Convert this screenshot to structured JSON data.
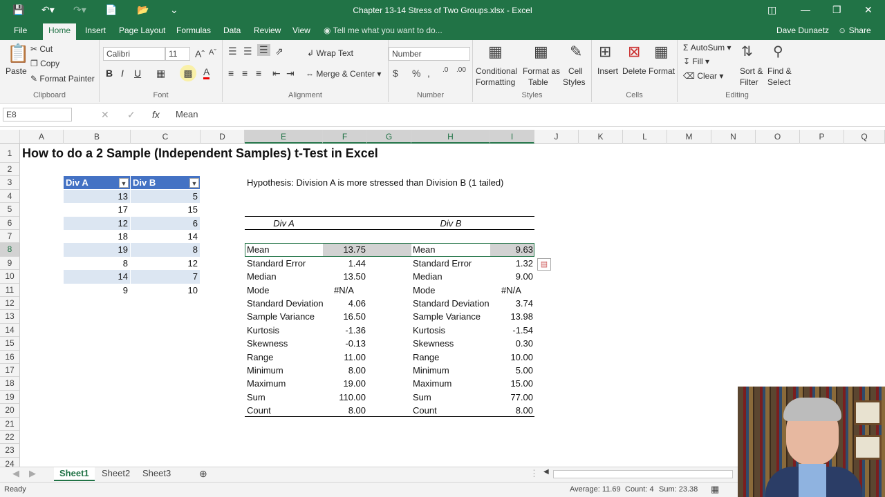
{
  "window": {
    "title": "Chapter 13-14 Stress of Two Groups.xlsx - Excel"
  },
  "quick_access": {
    "save": "save-icon",
    "undo": "undo-icon",
    "redo": "redo-icon"
  },
  "tabs": [
    {
      "label": "File"
    },
    {
      "label": "Home"
    },
    {
      "label": "Insert"
    },
    {
      "label": "Page Layout"
    },
    {
      "label": "Formulas"
    },
    {
      "label": "Data"
    },
    {
      "label": "Review"
    },
    {
      "label": "View"
    }
  ],
  "tell_me": "Tell me what you want to do...",
  "user": "Dave Dunaetz",
  "share": "Share",
  "ribbon": {
    "clipboard": {
      "paste": "Paste",
      "cut": "Cut",
      "copy": "Copy",
      "format_painter": "Format Painter",
      "label": "Clipboard"
    },
    "font": {
      "name": "Calibri",
      "size": "11",
      "label": "Font",
      "bold": "B",
      "italic": "I",
      "underline": "U"
    },
    "alignment": {
      "wrap": "Wrap Text",
      "merge": "Merge & Center",
      "label": "Alignment"
    },
    "number": {
      "format": "Number",
      "label": "Number"
    },
    "styles": {
      "cond": "Conditional",
      "cond2": "Formatting",
      "fmt_table": "Format as",
      "fmt_table2": "Table",
      "cell_styles": "Cell",
      "cell_styles2": "Styles",
      "label": "Styles"
    },
    "cells": {
      "insert": "Insert",
      "delete": "Delete",
      "format": "Format",
      "label": "Cells"
    },
    "editing": {
      "autosum": "AutoSum",
      "fill": "Fill",
      "clear": "Clear",
      "sort": "Sort &",
      "sort2": "Filter",
      "find": "Find &",
      "find2": "Select",
      "label": "Editing"
    }
  },
  "formula_bar": {
    "name_box": "E8",
    "formula": "Mean"
  },
  "columns": [
    "A",
    "B",
    "C",
    "D",
    "E",
    "F",
    "G",
    "H",
    "I",
    "J",
    "K",
    "L",
    "M",
    "N",
    "O",
    "P",
    "Q"
  ],
  "rows": [
    "1",
    "2",
    "3",
    "4",
    "5",
    "6",
    "7",
    "8",
    "9",
    "10",
    "11",
    "12",
    "13",
    "14",
    "15",
    "16",
    "17",
    "18",
    "19",
    "20",
    "21",
    "22",
    "23",
    "24"
  ],
  "sheet": {
    "title": "How to do a 2 Sample (Independent Samples) t-Test in Excel",
    "hypothesis": "Hypothesis: Division A is more stressed than Division B (1 tailed)",
    "table_headers": [
      "Div A",
      "Div B"
    ],
    "table_rows": [
      [
        "13",
        "5"
      ],
      [
        "17",
        "15"
      ],
      [
        "12",
        "6"
      ],
      [
        "18",
        "14"
      ],
      [
        "19",
        "8"
      ],
      [
        "8",
        "12"
      ],
      [
        "14",
        "7"
      ],
      [
        "9",
        "10"
      ]
    ],
    "stats_head": {
      "a": "Div A",
      "b": "Div B"
    },
    "stats": [
      [
        "Mean",
        "13.75",
        "Mean",
        "9.63"
      ],
      [
        "Standard Error",
        "1.44",
        "Standard Error",
        "1.32"
      ],
      [
        "Median",
        "13.50",
        "Median",
        "9.00"
      ],
      [
        "Mode",
        "#N/A",
        "Mode",
        "#N/A"
      ],
      [
        "Standard Deviation",
        "4.06",
        "Standard Deviation",
        "3.74"
      ],
      [
        "Sample Variance",
        "16.50",
        "Sample Variance",
        "13.98"
      ],
      [
        "Kurtosis",
        "-1.36",
        "Kurtosis",
        "-1.54"
      ],
      [
        "Skewness",
        "-0.13",
        "Skewness",
        "0.30"
      ],
      [
        "Range",
        "11.00",
        "Range",
        "10.00"
      ],
      [
        "Minimum",
        "8.00",
        "Minimum",
        "5.00"
      ],
      [
        "Maximum",
        "19.00",
        "Maximum",
        "15.00"
      ],
      [
        "Sum",
        "110.00",
        "Sum",
        "77.00"
      ],
      [
        "Count",
        "8.00",
        "Count",
        "8.00"
      ]
    ]
  },
  "sheet_tabs": [
    "Sheet1",
    "Sheet2",
    "Sheet3"
  ],
  "status": {
    "ready": "Ready",
    "average": "Average: 11.69",
    "count": "Count: 4",
    "sum": "Sum: 23.38"
  },
  "colors": {
    "excel_green": "#217346",
    "table_header": "#4472c4",
    "band": "#dce6f2"
  }
}
